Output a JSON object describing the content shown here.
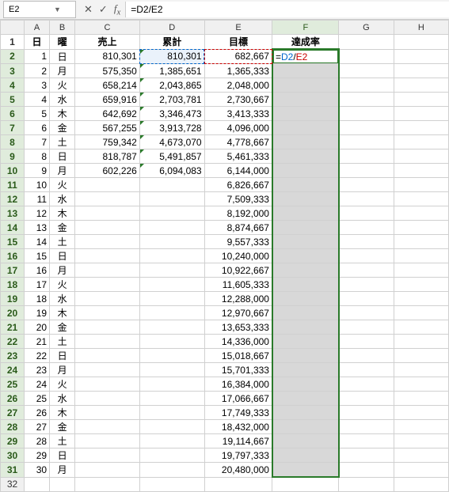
{
  "nameBox": "E2",
  "formula": "=D2/E2",
  "formula_parts": {
    "eq": "=",
    "ref1": "D2",
    "op": "/",
    "ref2": "E2"
  },
  "colHeaders": [
    "A",
    "B",
    "C",
    "D",
    "E",
    "F",
    "G",
    "H"
  ],
  "headerRow": {
    "A": "日",
    "B": "曜",
    "C": "売上",
    "D": "累計",
    "E": "目標",
    "F": "達成率"
  },
  "rows": [
    {
      "n": 1,
      "day": "日",
      "sales": "810,301",
      "cum": "810,301",
      "target": "682,667"
    },
    {
      "n": 2,
      "day": "月",
      "sales": "575,350",
      "cum": "1,385,651",
      "target": "1,365,333"
    },
    {
      "n": 3,
      "day": "火",
      "sales": "658,214",
      "cum": "2,043,865",
      "target": "2,048,000"
    },
    {
      "n": 4,
      "day": "水",
      "sales": "659,916",
      "cum": "2,703,781",
      "target": "2,730,667"
    },
    {
      "n": 5,
      "day": "木",
      "sales": "642,692",
      "cum": "3,346,473",
      "target": "3,413,333"
    },
    {
      "n": 6,
      "day": "金",
      "sales": "567,255",
      "cum": "3,913,728",
      "target": "4,096,000"
    },
    {
      "n": 7,
      "day": "土",
      "sales": "759,342",
      "cum": "4,673,070",
      "target": "4,778,667"
    },
    {
      "n": 8,
      "day": "日",
      "sales": "818,787",
      "cum": "5,491,857",
      "target": "5,461,333"
    },
    {
      "n": 9,
      "day": "月",
      "sales": "602,226",
      "cum": "6,094,083",
      "target": "6,144,000"
    },
    {
      "n": 10,
      "day": "火",
      "sales": "",
      "cum": "",
      "target": "6,826,667"
    },
    {
      "n": 11,
      "day": "水",
      "sales": "",
      "cum": "",
      "target": "7,509,333"
    },
    {
      "n": 12,
      "day": "木",
      "sales": "",
      "cum": "",
      "target": "8,192,000"
    },
    {
      "n": 13,
      "day": "金",
      "sales": "",
      "cum": "",
      "target": "8,874,667"
    },
    {
      "n": 14,
      "day": "土",
      "sales": "",
      "cum": "",
      "target": "9,557,333"
    },
    {
      "n": 15,
      "day": "日",
      "sales": "",
      "cum": "",
      "target": "10,240,000"
    },
    {
      "n": 16,
      "day": "月",
      "sales": "",
      "cum": "",
      "target": "10,922,667"
    },
    {
      "n": 17,
      "day": "火",
      "sales": "",
      "cum": "",
      "target": "11,605,333"
    },
    {
      "n": 18,
      "day": "水",
      "sales": "",
      "cum": "",
      "target": "12,288,000"
    },
    {
      "n": 19,
      "day": "木",
      "sales": "",
      "cum": "",
      "target": "12,970,667"
    },
    {
      "n": 20,
      "day": "金",
      "sales": "",
      "cum": "",
      "target": "13,653,333"
    },
    {
      "n": 21,
      "day": "土",
      "sales": "",
      "cum": "",
      "target": "14,336,000"
    },
    {
      "n": 22,
      "day": "日",
      "sales": "",
      "cum": "",
      "target": "15,018,667"
    },
    {
      "n": 23,
      "day": "月",
      "sales": "",
      "cum": "",
      "target": "15,701,333"
    },
    {
      "n": 24,
      "day": "火",
      "sales": "",
      "cum": "",
      "target": "16,384,000"
    },
    {
      "n": 25,
      "day": "水",
      "sales": "",
      "cum": "",
      "target": "17,066,667"
    },
    {
      "n": 26,
      "day": "木",
      "sales": "",
      "cum": "",
      "target": "17,749,333"
    },
    {
      "n": 27,
      "day": "金",
      "sales": "",
      "cum": "",
      "target": "18,432,000"
    },
    {
      "n": 28,
      "day": "土",
      "sales": "",
      "cum": "",
      "target": "19,114,667"
    },
    {
      "n": 29,
      "day": "日",
      "sales": "",
      "cum": "",
      "target": "19,797,333"
    },
    {
      "n": 30,
      "day": "月",
      "sales": "",
      "cum": "",
      "target": "20,480,000"
    }
  ],
  "selection": {
    "col": "F",
    "startRow": 2,
    "endRow": 31,
    "activeRow": 2
  }
}
